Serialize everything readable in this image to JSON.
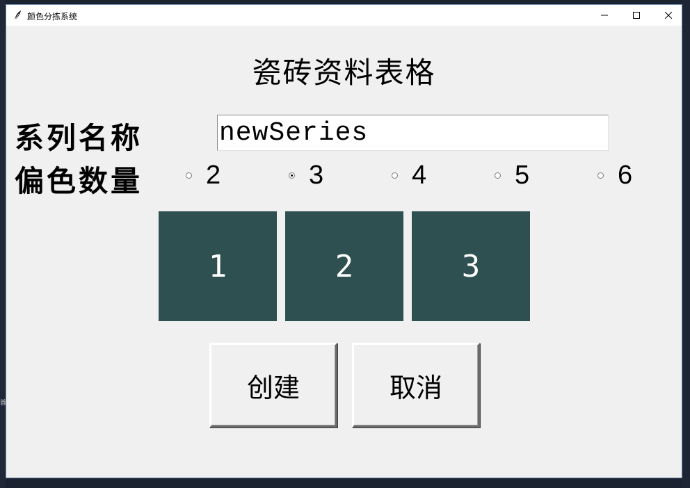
{
  "window": {
    "title": "颜色分拣系统",
    "icon": "feather-icon",
    "controls": {
      "minimize": "minimize-icon",
      "maximize": "maximize-icon",
      "close": "close-icon"
    }
  },
  "page": {
    "title": "瓷砖资料表格"
  },
  "form": {
    "series_label": "系列名称",
    "series_value": "newSeries",
    "count_label": "偏色数量",
    "count_options": [
      "2",
      "3",
      "4",
      "5",
      "6"
    ],
    "count_selected": "3"
  },
  "swatches": [
    {
      "label": "1",
      "color": "#2f5050"
    },
    {
      "label": "2",
      "color": "#2f5050"
    },
    {
      "label": "3",
      "color": "#2f5050"
    }
  ],
  "actions": {
    "create_label": "创建",
    "cancel_label": "取消"
  },
  "backdrop": {
    "edge_glyph": "首"
  }
}
